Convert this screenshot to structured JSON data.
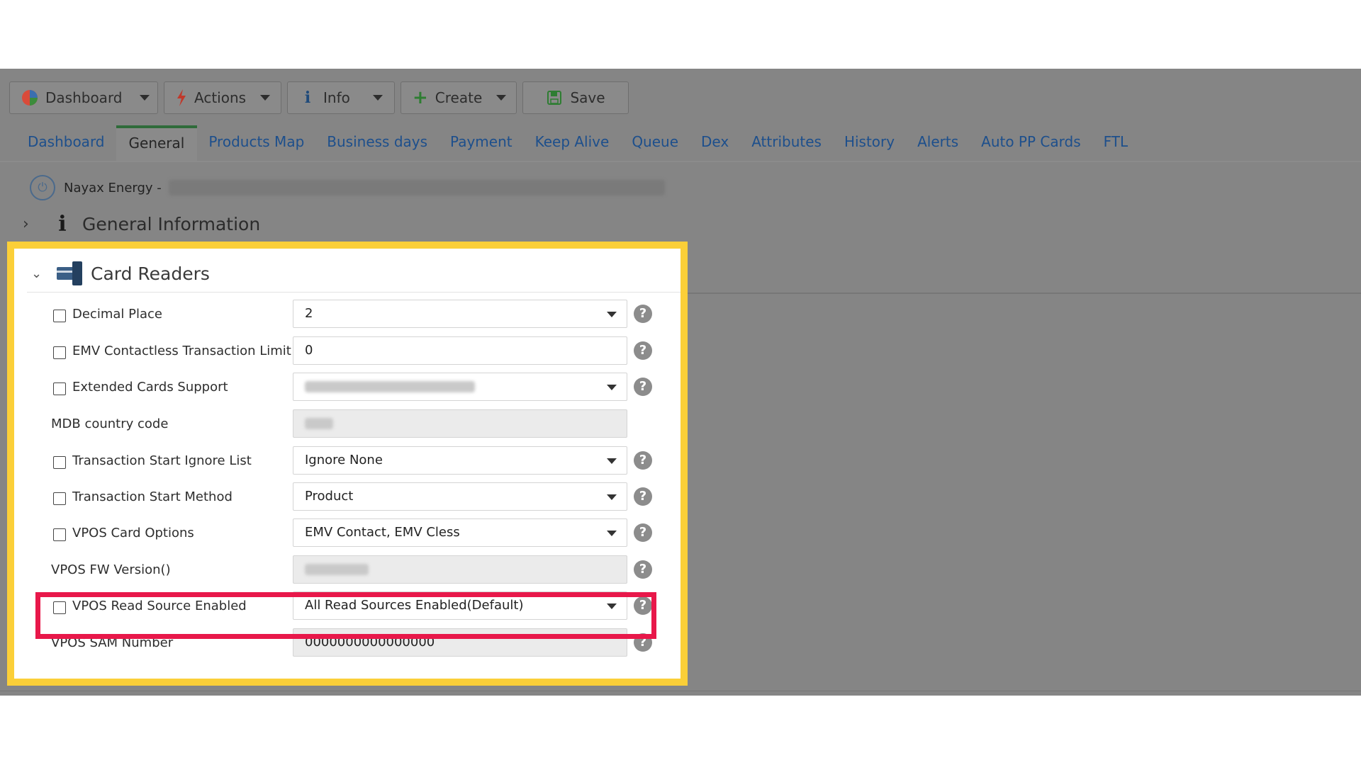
{
  "toolbar": {
    "dashboard_label": "Dashboard",
    "actions_label": "Actions",
    "info_label": "Info",
    "create_label": "Create",
    "save_label": "Save"
  },
  "tabs": [
    "Dashboard",
    "General",
    "Products Map",
    "Business days",
    "Payment",
    "Keep Alive",
    "Queue",
    "Dex",
    "Attributes",
    "History",
    "Alerts",
    "Auto PP Cards",
    "FTL"
  ],
  "active_tab": "General",
  "breadcrumb": {
    "prefix": "Nayax Energy -"
  },
  "general_information": {
    "title": "General Information"
  },
  "card_readers": {
    "title": "Card Readers",
    "fields": [
      {
        "label": "Decimal Place",
        "value": "2",
        "has_checkbox": true,
        "type": "select",
        "help": true
      },
      {
        "label": "EMV Contactless Transaction Limit",
        "value": "0",
        "has_checkbox": true,
        "type": "text",
        "help": true
      },
      {
        "label": "Extended Cards Support",
        "value": "",
        "has_checkbox": true,
        "type": "select",
        "help": true,
        "obscured": true
      },
      {
        "label": "MDB country code",
        "value": "",
        "has_checkbox": false,
        "type": "readonly",
        "help": false,
        "obscured": true
      },
      {
        "label": "Transaction Start Ignore List",
        "value": "Ignore None",
        "has_checkbox": true,
        "type": "select",
        "help": true
      },
      {
        "label": "Transaction Start Method",
        "value": "Product",
        "has_checkbox": true,
        "type": "select",
        "help": true
      },
      {
        "label": "VPOS Card Options",
        "value": "EMV Contact, EMV Cless",
        "has_checkbox": true,
        "type": "select",
        "help": true
      },
      {
        "label": "VPOS FW Version()",
        "value": "",
        "has_checkbox": false,
        "type": "readonly",
        "help": true,
        "obscured": true
      },
      {
        "label": "VPOS Read Source Enabled",
        "value": "All Read Sources Enabled(Default)",
        "has_checkbox": true,
        "type": "select",
        "help": true,
        "highlighted": true
      },
      {
        "label": "VPOS SAM Number",
        "value": "0000000000000000",
        "has_checkbox": false,
        "type": "readonly",
        "help": true
      }
    ]
  },
  "help_glyph": "?",
  "colors": {
    "panel_outline": "#fbcf38",
    "row_highlight": "#e8184a",
    "tab_link": "#1d4f8c",
    "active_tab_accent": "#2f6b3a"
  },
  "icons": {
    "dashboard": "pie-chart-icon",
    "actions": "lightning-icon",
    "info": "info-icon",
    "create": "plus-icon",
    "save": "floppy-disk-icon",
    "breadcrumb": "plug-icon",
    "card_readers": "card-reader-icon"
  }
}
